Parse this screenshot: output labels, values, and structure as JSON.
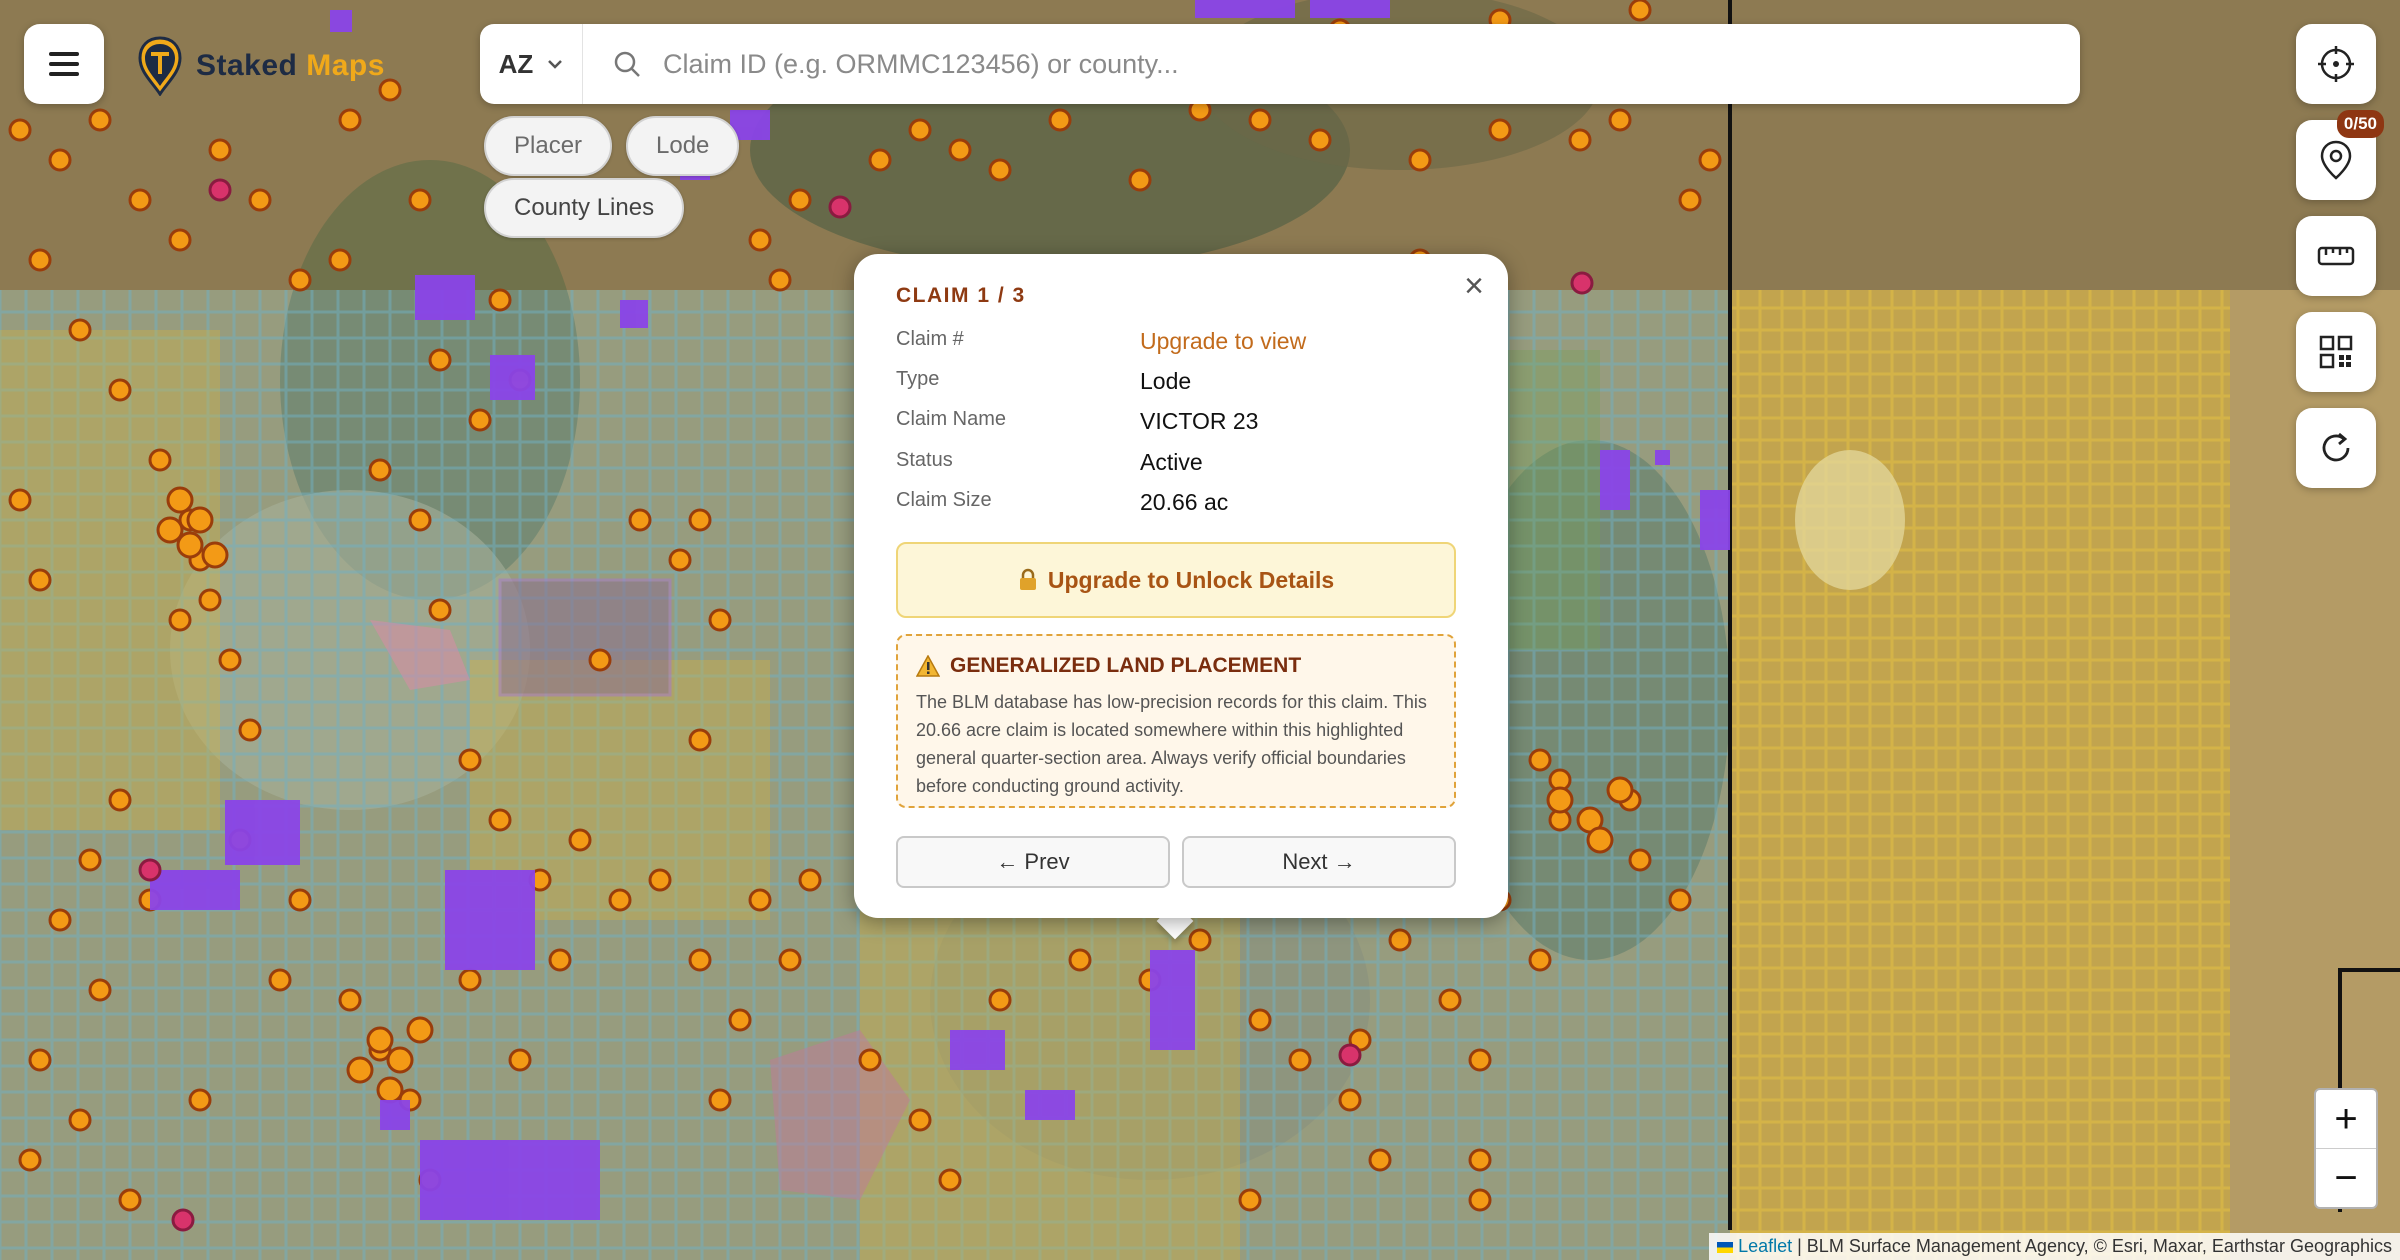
{
  "brand": {
    "part1": "Staked",
    "part2": "Maps"
  },
  "search": {
    "state": "AZ",
    "placeholder": "Claim ID (e.g. ORMMC123456) or county..."
  },
  "filters": {
    "placer": "Placer",
    "lode": "Lode",
    "county_lines": "County Lines"
  },
  "tools": {
    "pin_badge": "0/50"
  },
  "popup": {
    "title": "CLAIM 1 / 3",
    "rows": [
      {
        "label": "Claim #",
        "value": "Upgrade to view"
      },
      {
        "label": "Type",
        "value": "Lode"
      },
      {
        "label": "Claim Name",
        "value": "VICTOR 23"
      },
      {
        "label": "Status",
        "value": "Active"
      },
      {
        "label": "Claim Size",
        "value": "20.66 ac"
      }
    ],
    "unlock_label": "Upgrade to Unlock Details",
    "warning_title": "GENERALIZED LAND PLACEMENT",
    "warning_text": "The BLM database has low-precision records for this claim. This 20.66 acre claim is located somewhere within this highlighted general quarter-section area. Always verify official boundaries before conducting ground activity.",
    "prev_label": "← Prev",
    "next_label": "Next →"
  },
  "zoom": {
    "in": "+",
    "out": "−"
  },
  "attribution": {
    "link": "Leaflet",
    "text": " | BLM Surface Management Agency, © Esri, Maxar, Earthstar Geographics"
  },
  "colors": {
    "claim_marker": "#f39a16",
    "claim_marker_border": "#9a3d0b",
    "claim_block": "#8a44e8",
    "alert_marker": "#d8336b",
    "brand_navy": "#1d2b44",
    "brand_gold": "#f0a91a",
    "popup_accent": "#8e3a12"
  }
}
